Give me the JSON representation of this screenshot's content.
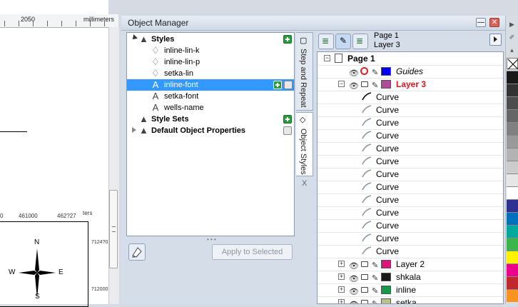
{
  "canvas": {
    "ruler_top_label": "2050",
    "ruler_unit": "millimeters",
    "map_ruler_labels": [
      "0",
      "461000",
      "462?27",
      "ters"
    ],
    "map_side_labels": [
      "7124?0",
      "712000"
    ],
    "compass_letters": {
      "n": "N",
      "s": "S",
      "e": "E",
      "w": "W"
    }
  },
  "window": {
    "title": "Object Manager",
    "minimize_label": "—",
    "close_label": "✕"
  },
  "styles_panel": {
    "items": [
      {
        "label": "Styles",
        "bold": true,
        "icon": "styles-icon",
        "expander": "expanded"
      },
      {
        "label": "inline-lin-k",
        "icon": "outline-style-icon"
      },
      {
        "label": "inline-lin-p",
        "icon": "outline-style-icon"
      },
      {
        "label": "setka-lin",
        "icon": "outline-style-icon"
      },
      {
        "label": "inline-font",
        "icon": "character-style-icon",
        "selected": true
      },
      {
        "label": "setka-font",
        "icon": "character-style-icon"
      },
      {
        "label": "wells-name",
        "icon": "character-style-icon"
      },
      {
        "label": "Style Sets",
        "bold": true,
        "icon": "style-sets-icon"
      },
      {
        "label": "Default Object Properties",
        "bold": true,
        "icon": "default-props-icon",
        "expander": "collapsed"
      }
    ],
    "apply_button": "Apply to Selected"
  },
  "vertical_tabs": [
    {
      "label": "Step and Repeat"
    },
    {
      "label": "Object Styles"
    }
  ],
  "tab_close": "X",
  "layers": {
    "page_name": "Page 1",
    "layer_name": "Layer 3",
    "tree": [
      {
        "label": "Page 1",
        "kind": "page",
        "expander": "−"
      },
      {
        "label": "Guides",
        "kind": "layer",
        "italic": true,
        "color": "#0000ff"
      },
      {
        "label": "Layer 3",
        "kind": "layer",
        "active": true,
        "color": "#b04a9a",
        "expander": "−"
      },
      {
        "label": "Curve",
        "kind": "object",
        "dark": true
      },
      {
        "label": "Curve",
        "kind": "object"
      },
      {
        "label": "Curve",
        "kind": "object"
      },
      {
        "label": "Curve",
        "kind": "object"
      },
      {
        "label": "Curve",
        "kind": "object"
      },
      {
        "label": "Curve",
        "kind": "object"
      },
      {
        "label": "Curve",
        "kind": "object"
      },
      {
        "label": "Curve",
        "kind": "object"
      },
      {
        "label": "Curve",
        "kind": "object"
      },
      {
        "label": "Curve",
        "kind": "object"
      },
      {
        "label": "Curve",
        "kind": "object"
      },
      {
        "label": "Curve",
        "kind": "object"
      },
      {
        "label": "Curve",
        "kind": "object"
      },
      {
        "label": "Layer 2",
        "kind": "layer",
        "color": "#e0137c",
        "expander": "+"
      },
      {
        "label": "shkala",
        "kind": "layer",
        "color": "#1a1a1a",
        "expander": "+"
      },
      {
        "label": "inline",
        "kind": "layer",
        "color": "#159a4a",
        "expander": "+"
      },
      {
        "label": "setka",
        "kind": "layer",
        "color": "#b9c28a",
        "expander": "+"
      }
    ]
  },
  "palette": {
    "colors": [
      "#1a1a1a",
      "#333333",
      "#4d4d4d",
      "#666666",
      "#808080",
      "#999999",
      "#b3b3b3",
      "#cccccc",
      "#e6e6e6",
      "#ffffff",
      "#2e3192",
      "#0071bc",
      "#00a99d",
      "#39b54a",
      "#fff200",
      "#ec008c",
      "#c1272d",
      "#f7931e"
    ]
  }
}
